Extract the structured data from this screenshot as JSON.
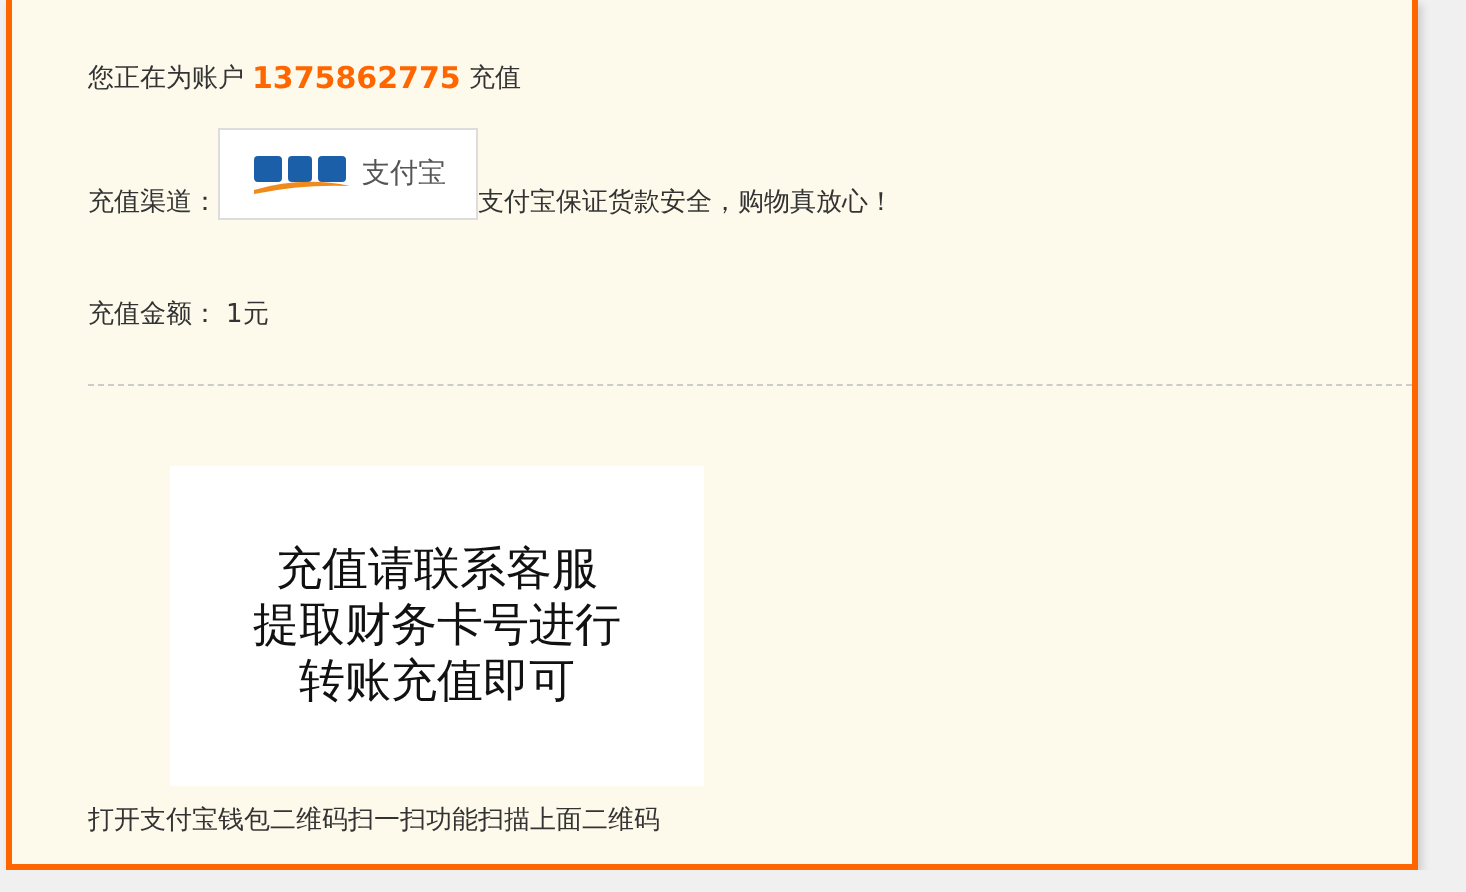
{
  "account_line": {
    "prefix": "您正在为账户",
    "account": "1375862775",
    "suffix": "充值"
  },
  "channel": {
    "label": "充值渠道：",
    "logo_text": "支付宝",
    "note": "支付宝保证货款安全，购物真放心！"
  },
  "amount": {
    "label": "充值金额：",
    "value": "1元"
  },
  "qr_card": {
    "lines": [
      "充值请联系客服",
      "提取财务卡号进行",
      "转账充值即可"
    ]
  },
  "caption": "打开支付宝钱包二维码扫一扫功能扫描上面二维码"
}
